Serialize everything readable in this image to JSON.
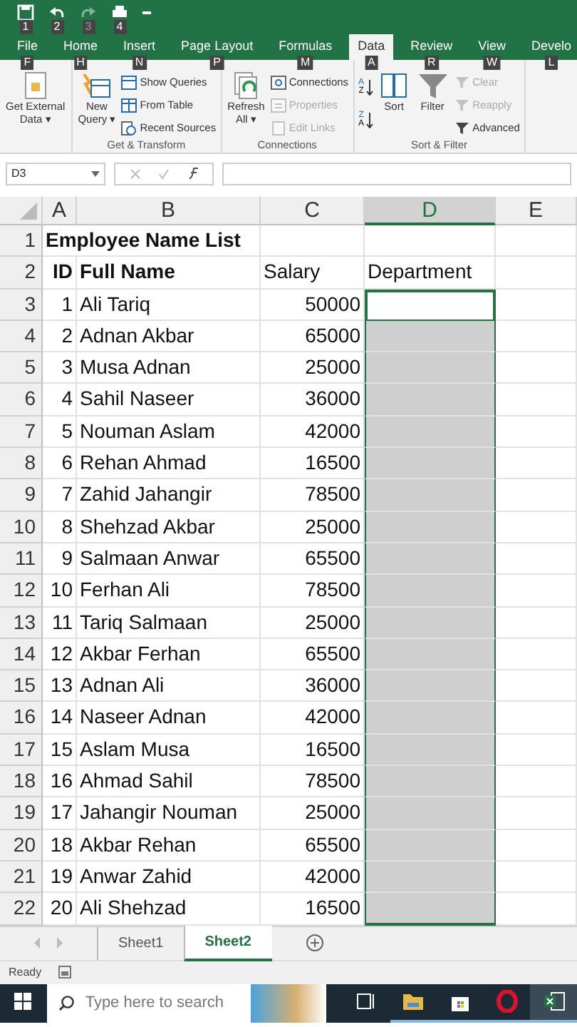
{
  "quick_access": [
    {
      "kind": "save",
      "keytip": "1"
    },
    {
      "kind": "undo",
      "keytip": "2"
    },
    {
      "kind": "redo",
      "keytip": "3",
      "disabled": true
    },
    {
      "kind": "print",
      "keytip": "4"
    }
  ],
  "tabs": [
    {
      "label": "File",
      "keytip": "F",
      "selected": false
    },
    {
      "label": "Home",
      "keytip": "H",
      "selected": false
    },
    {
      "label": "Insert",
      "keytip": "N",
      "selected": false
    },
    {
      "label": "Page Layout",
      "keytip": "P",
      "selected": false
    },
    {
      "label": "Formulas",
      "keytip": "M",
      "selected": false
    },
    {
      "label": "Data",
      "keytip": "A",
      "selected": true
    },
    {
      "label": "Review",
      "keytip": "R",
      "selected": false
    },
    {
      "label": "View",
      "keytip": "W",
      "selected": false
    },
    {
      "label": "Develo",
      "keytip": "L",
      "selected": false
    }
  ],
  "ribbon_groups": [
    {
      "items": [
        {
          "kind": "large",
          "lines": [
            "Get External",
            "Data ▾"
          ],
          "disabled": false
        }
      ]
    },
    {
      "label": "Get & Transform",
      "items": [
        {
          "kind": "large",
          "lines": [
            "New",
            "Query ▾"
          ],
          "disabled": false
        },
        {
          "kind": "small",
          "lines": [
            "Show Queries"
          ],
          "disabled": false
        },
        {
          "kind": "small",
          "lines": [
            "From Table"
          ],
          "disabled": false
        },
        {
          "kind": "small",
          "lines": [
            "Recent Sources"
          ],
          "disabled": false
        }
      ]
    },
    {
      "label": "Connections",
      "items": [
        {
          "kind": "large",
          "lines": [
            "Refresh",
            "All ▾"
          ],
          "disabled": false
        },
        {
          "kind": "small",
          "lines": [
            "Connections"
          ],
          "disabled": false
        },
        {
          "kind": "small",
          "lines": [
            "Properties"
          ],
          "disabled": true
        },
        {
          "kind": "small",
          "lines": [
            "Edit Links"
          ],
          "disabled": true
        }
      ]
    },
    {
      "label": "Sort & Filter",
      "items": [
        {
          "kind": "sortpair",
          "buttons": [
            {
              "top": "A",
              "bottom": "Z"
            },
            {
              "top": "Z",
              "bottom": "A"
            }
          ]
        },
        {
          "kind": "large",
          "lines": [
            "Sort"
          ],
          "disabled": false
        },
        {
          "kind": "large",
          "lines": [
            "Filter"
          ],
          "disabled": false
        },
        {
          "kind": "small",
          "lines": [
            "Clear"
          ],
          "disabled": true
        },
        {
          "kind": "small",
          "lines": [
            "Reapply"
          ],
          "disabled": true
        },
        {
          "kind": "small",
          "lines": [
            "Advanced"
          ],
          "disabled": false
        }
      ]
    }
  ],
  "formula_bar": {
    "name_box": "D3"
  },
  "columns": [
    {
      "label": "A",
      "selected": false
    },
    {
      "label": "B",
      "selected": false
    },
    {
      "label": "C",
      "selected": false
    },
    {
      "label": "D",
      "selected": true
    },
    {
      "label": "E",
      "selected": false
    }
  ],
  "rows": [
    {
      "number": "1",
      "kind": "title",
      "title": "Employee Name List"
    },
    {
      "number": "2",
      "kind": "header",
      "id": "ID",
      "full_name": "Full Name",
      "salary": "Salary",
      "department": "Department"
    },
    {
      "number": "3",
      "kind": "data",
      "id": "1",
      "full_name": "Ali Tariq",
      "salary": "50000",
      "active": true
    },
    {
      "number": "4",
      "kind": "data",
      "id": "2",
      "full_name": "Adnan Akbar",
      "salary": "65000",
      "selected": true
    },
    {
      "number": "5",
      "kind": "data",
      "id": "3",
      "full_name": "Musa Adnan",
      "salary": "25000",
      "selected": true
    },
    {
      "number": "6",
      "kind": "data",
      "id": "4",
      "full_name": "Sahil Naseer",
      "salary": "36000",
      "selected": true
    },
    {
      "number": "7",
      "kind": "data",
      "id": "5",
      "full_name": "Nouman Aslam",
      "salary": "42000",
      "selected": true
    },
    {
      "number": "8",
      "kind": "data",
      "id": "6",
      "full_name": "Rehan Ahmad",
      "salary": "16500",
      "selected": true
    },
    {
      "number": "9",
      "kind": "data",
      "id": "7",
      "full_name": "Zahid Jahangir",
      "salary": "78500",
      "selected": true
    },
    {
      "number": "10",
      "kind": "data",
      "id": "8",
      "full_name": "Shehzad Akbar",
      "salary": "25000",
      "selected": true
    },
    {
      "number": "11",
      "kind": "data",
      "id": "9",
      "full_name": "Salmaan Anwar",
      "salary": "65500",
      "selected": true
    },
    {
      "number": "12",
      "kind": "data",
      "id": "10",
      "full_name": "Ferhan Ali",
      "salary": "78500",
      "selected": true
    },
    {
      "number": "13",
      "kind": "data",
      "id": "11",
      "full_name": "Tariq Salmaan",
      "salary": "25000",
      "selected": true
    },
    {
      "number": "14",
      "kind": "data",
      "id": "12",
      "full_name": "Akbar Ferhan",
      "salary": "65500",
      "selected": true
    },
    {
      "number": "15",
      "kind": "data",
      "id": "13",
      "full_name": "Adnan Ali",
      "salary": "36000",
      "selected": true
    },
    {
      "number": "16",
      "kind": "data",
      "id": "14",
      "full_name": "Naseer Adnan",
      "salary": "42000",
      "selected": true
    },
    {
      "number": "17",
      "kind": "data",
      "id": "15",
      "full_name": "Aslam Musa",
      "salary": "16500",
      "selected": true
    },
    {
      "number": "18",
      "kind": "data",
      "id": "16",
      "full_name": "Ahmad Sahil",
      "salary": "78500",
      "selected": true
    },
    {
      "number": "19",
      "kind": "data",
      "id": "17",
      "full_name": "Jahangir Nouman",
      "salary": "25000",
      "selected": true
    },
    {
      "number": "20",
      "kind": "data",
      "id": "18",
      "full_name": "Akbar Rehan",
      "salary": "65500",
      "selected": true
    },
    {
      "number": "21",
      "kind": "data",
      "id": "19",
      "full_name": "Anwar Zahid",
      "salary": "42000",
      "selected": true
    },
    {
      "number": "22",
      "kind": "data",
      "id": "20",
      "full_name": "Ali Shehzad",
      "salary": "16500",
      "selected": true
    }
  ],
  "sheets": [
    {
      "label": "Sheet1",
      "selected": false
    },
    {
      "label": "Sheet2",
      "selected": true
    }
  ],
  "status_bar": {
    "text": "Ready"
  },
  "taskbar": {
    "search": {
      "placeholder": "Type here to search"
    },
    "apps": [
      {
        "kind": "taskview",
        "active": false
      },
      {
        "kind": "folder",
        "active": true
      },
      {
        "kind": "store",
        "active": true
      },
      {
        "kind": "ring",
        "active": true
      },
      {
        "kind": "sheet",
        "active": true
      }
    ]
  }
}
